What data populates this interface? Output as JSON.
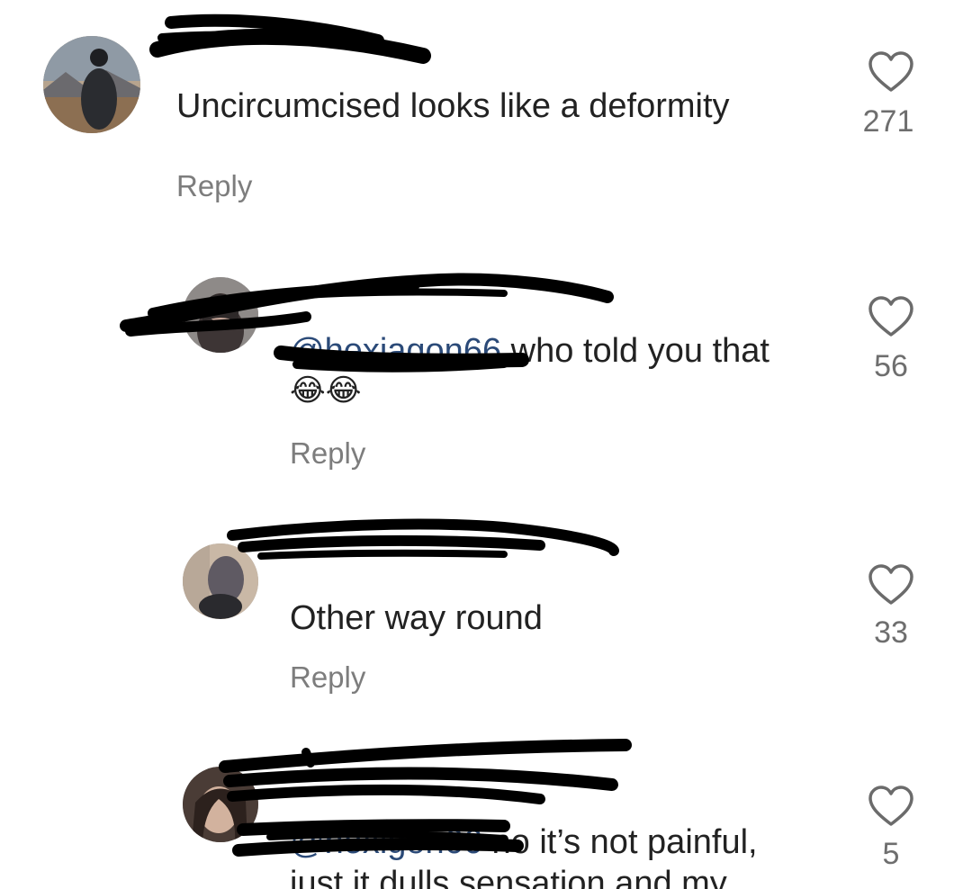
{
  "comments": [
    {
      "username": "",
      "text": "Uncircumcised looks like a deformity",
      "reply_label": "Reply",
      "likes": "271"
    },
    {
      "username": "",
      "mention": "@hexiagon66",
      "text": "who told you that",
      "emoji": "😂😂",
      "reply_label": "Reply",
      "likes": "56"
    },
    {
      "username": "",
      "text": "Other way round",
      "reply_label": "Reply",
      "likes": "33"
    },
    {
      "username": "",
      "mention": "@hexigon66",
      "text": "no it’s not painful,",
      "text_line2": "just it dulls sensation and my",
      "likes": "5"
    }
  ],
  "icons": {
    "like": "heart-outline-icon"
  },
  "colors": {
    "mention": "#2b4a78",
    "secondary_text": "#7d7d7d",
    "redaction": "#000000"
  }
}
